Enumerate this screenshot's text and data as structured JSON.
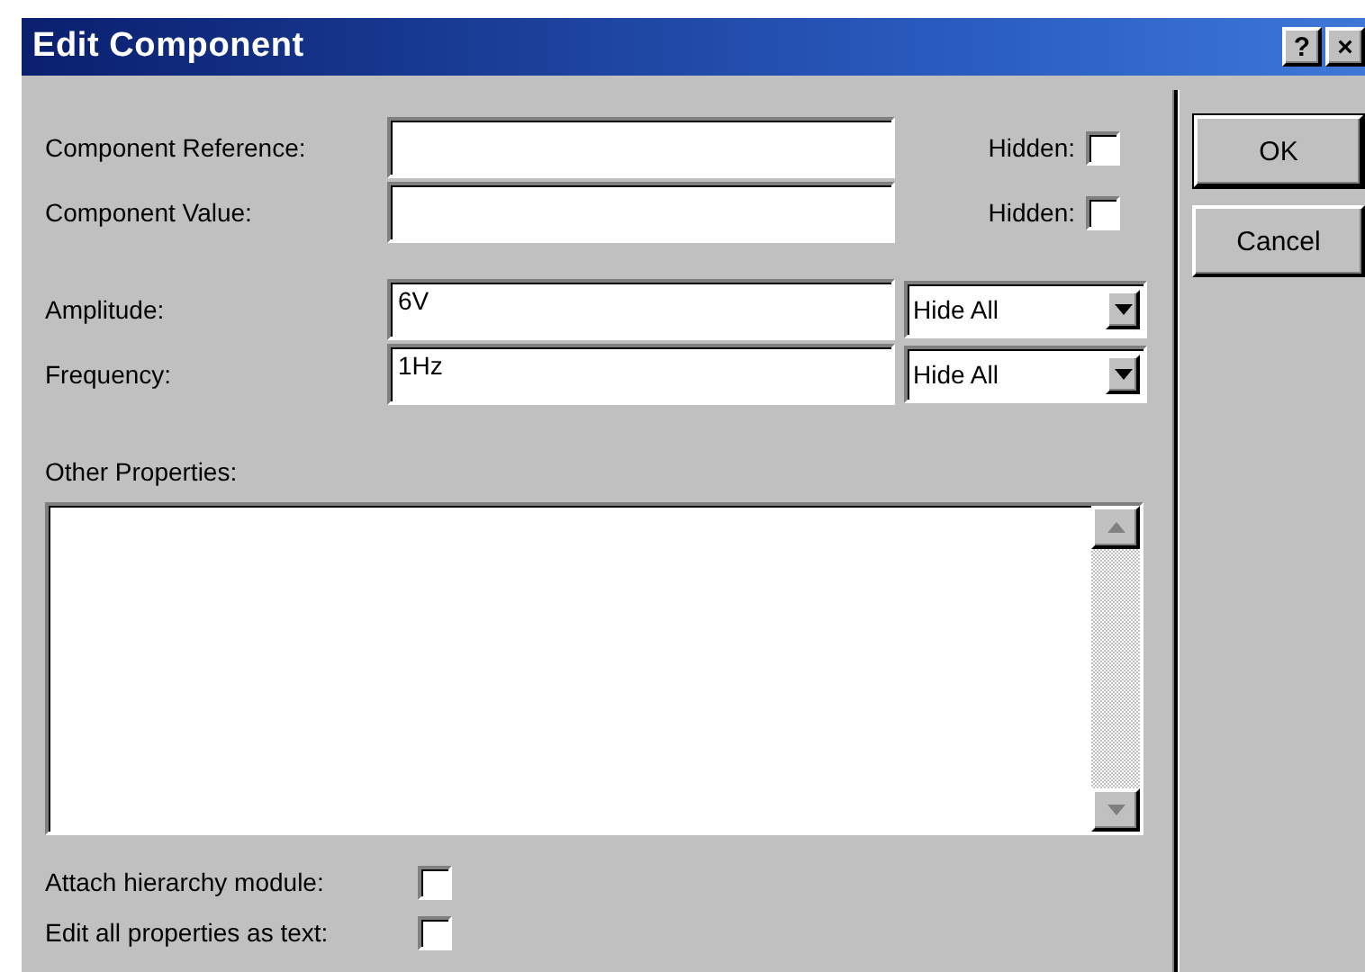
{
  "window": {
    "title": "Edit Component",
    "title_buttons": [
      "?",
      "×"
    ]
  },
  "fields": [
    {
      "label": "Component Reference:",
      "hidden_label": "Hidden:",
      "hidden": false
    },
    {
      "label": "Component Value:",
      "hidden_label": "Hidden:",
      "hidden": false
    }
  ],
  "properties": [
    {
      "label": "Amplitude:",
      "value": "6V",
      "visibility": "Hide All"
    },
    {
      "label": "Frequency:",
      "value": "1Hz",
      "visibility": "Hide All"
    }
  ],
  "other_properties": {
    "label": "Other Properties:"
  },
  "options": [
    {
      "label": "Attach hierarchy module:",
      "checked": false
    },
    {
      "label": "Edit all properties as text:",
      "checked": false
    }
  ],
  "buttons": [
    {
      "label": "OK",
      "default": true
    },
    {
      "label": "Cancel",
      "default": false
    }
  ]
}
